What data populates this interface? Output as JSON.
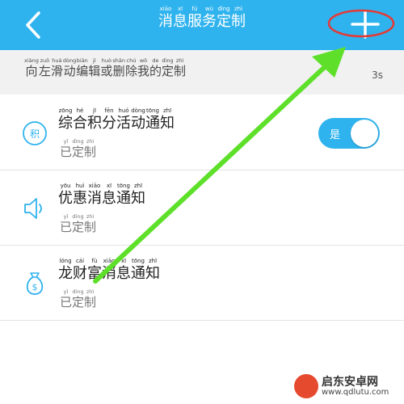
{
  "header": {
    "title_chars": [
      {
        "py": "xiāo",
        "ch": "消"
      },
      {
        "py": "xī",
        "ch": "息"
      },
      {
        "py": "fú",
        "ch": "服"
      },
      {
        "py": "wù",
        "ch": "务"
      },
      {
        "py": "dìng",
        "ch": "定"
      },
      {
        "py": "zhì",
        "ch": "制"
      }
    ],
    "back_icon": "chevron-left-icon",
    "add_icon": "plus-icon",
    "bg_color": "#2fb3ee"
  },
  "hint": {
    "chars": [
      {
        "py": "xiàng",
        "ch": "向"
      },
      {
        "py": "zuǒ",
        "ch": "左"
      },
      {
        "py": "huá",
        "ch": "滑"
      },
      {
        "py": "dòng",
        "ch": "动"
      },
      {
        "py": "biān",
        "ch": "编"
      },
      {
        "py": "jí",
        "ch": "辑"
      },
      {
        "py": "huò",
        "ch": "或"
      },
      {
        "py": "shān",
        "ch": "删"
      },
      {
        "py": "chú",
        "ch": "除"
      },
      {
        "py": "wǒ",
        "ch": "我"
      },
      {
        "py": "de",
        "ch": "的"
      },
      {
        "py": "dìng",
        "ch": "定"
      },
      {
        "py": "zhì",
        "ch": "制"
      }
    ],
    "countdown": "3s"
  },
  "rows": [
    {
      "icon": "points-badge-icon",
      "icon_text": "积",
      "title_chars": [
        {
          "py": "zōng",
          "ch": "综"
        },
        {
          "py": "hé",
          "ch": "合"
        },
        {
          "py": "jī",
          "ch": "积"
        },
        {
          "py": "fēn",
          "ch": "分"
        },
        {
          "py": "huó",
          "ch": "活"
        },
        {
          "py": "dòng",
          "ch": "动"
        },
        {
          "py": "tōng",
          "ch": "通"
        },
        {
          "py": "zhī",
          "ch": "知"
        }
      ],
      "status_chars": [
        {
          "py": "yǐ",
          "ch": "已"
        },
        {
          "py": "dìng",
          "ch": "定"
        },
        {
          "py": "zhì",
          "ch": "制"
        }
      ],
      "toggle_label": "是",
      "toggle_on": true
    },
    {
      "icon": "speaker-icon",
      "title_chars": [
        {
          "py": "yōu",
          "ch": "优"
        },
        {
          "py": "huì",
          "ch": "惠"
        },
        {
          "py": "xiāo",
          "ch": "消"
        },
        {
          "py": "xī",
          "ch": "息"
        },
        {
          "py": "tōng",
          "ch": "通"
        },
        {
          "py": "zhī",
          "ch": "知"
        }
      ],
      "status_chars": [
        {
          "py": "yǐ",
          "ch": "已"
        },
        {
          "py": "dìng",
          "ch": "定"
        },
        {
          "py": "zhì",
          "ch": "制"
        }
      ]
    },
    {
      "icon": "money-bag-icon",
      "icon_text": "$",
      "title_chars": [
        {
          "py": "lóng",
          "ch": "龙"
        },
        {
          "py": "cái",
          "ch": "财"
        },
        {
          "py": "fù",
          "ch": "富"
        },
        {
          "py": "xiāo",
          "ch": "消"
        },
        {
          "py": "xī",
          "ch": "息"
        },
        {
          "py": "tōng",
          "ch": "通"
        },
        {
          "py": "zhī",
          "ch": "知"
        }
      ],
      "status_chars": [
        {
          "py": "yǐ",
          "ch": "已"
        },
        {
          "py": "dìng",
          "ch": "定"
        },
        {
          "py": "zhì",
          "ch": "制"
        }
      ]
    }
  ],
  "watermark": {
    "name": "启东安卓网",
    "url": "www.qdlutu.com"
  },
  "colors": {
    "accent": "#2fb3ee",
    "annotation_arrow": "#5ee02a",
    "annotation_circle": "#e53935"
  }
}
